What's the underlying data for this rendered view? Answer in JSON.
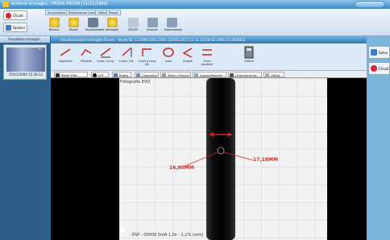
{
  "window": {
    "title": "Archivio immagini - PROVA PROVA (11/11/1999)"
  },
  "ribbon": {
    "close_label": "Chiudi",
    "options_label": "Opzioni",
    "tabs": [
      "Acquisizione",
      "Elaborazione Immagini",
      "Utilita",
      "Report"
    ],
    "tools": [
      "Ricerca",
      "Dicom",
      "Visualizzatore",
      "Immagini",
      "DICOM",
      "Scanner",
      "Esportazione"
    ],
    "view_btn": "Visualizza immagini"
  },
  "thumb": {
    "label": "25/01/2000 15:58:12",
    "tag": "1m"
  },
  "inner": {
    "title": "Visualizzazione Immagini Dicom - Study ID: 1.2.840.1001.1001.12345.2017.11.11 15:58:12.1001.11.05/2012",
    "tools": [
      "Segmento",
      "Multiple",
      "Linea / Lung.",
      "Linea / Alt.",
      "Linea a Lung. Alt.",
      "Area",
      "Angolo",
      "Linee parallele",
      "Calibra"
    ],
    "row2": [
      "Reset Filtri",
      "LUT",
      "Ruota",
      "Capovolgi",
      "Testo / Freccia",
      "Ingrandimento",
      "Orientamento",
      "Utilita"
    ]
  },
  "viewer": {
    "label": "Fotografie EVO",
    "measure_left": "16,80MM",
    "measure_right": "17,18MM",
    "footer": "- DSP - 00000 0mA 1,0s - 1,1% (mm)"
  },
  "right": {
    "save": "Salva",
    "close": "Chiudi"
  }
}
